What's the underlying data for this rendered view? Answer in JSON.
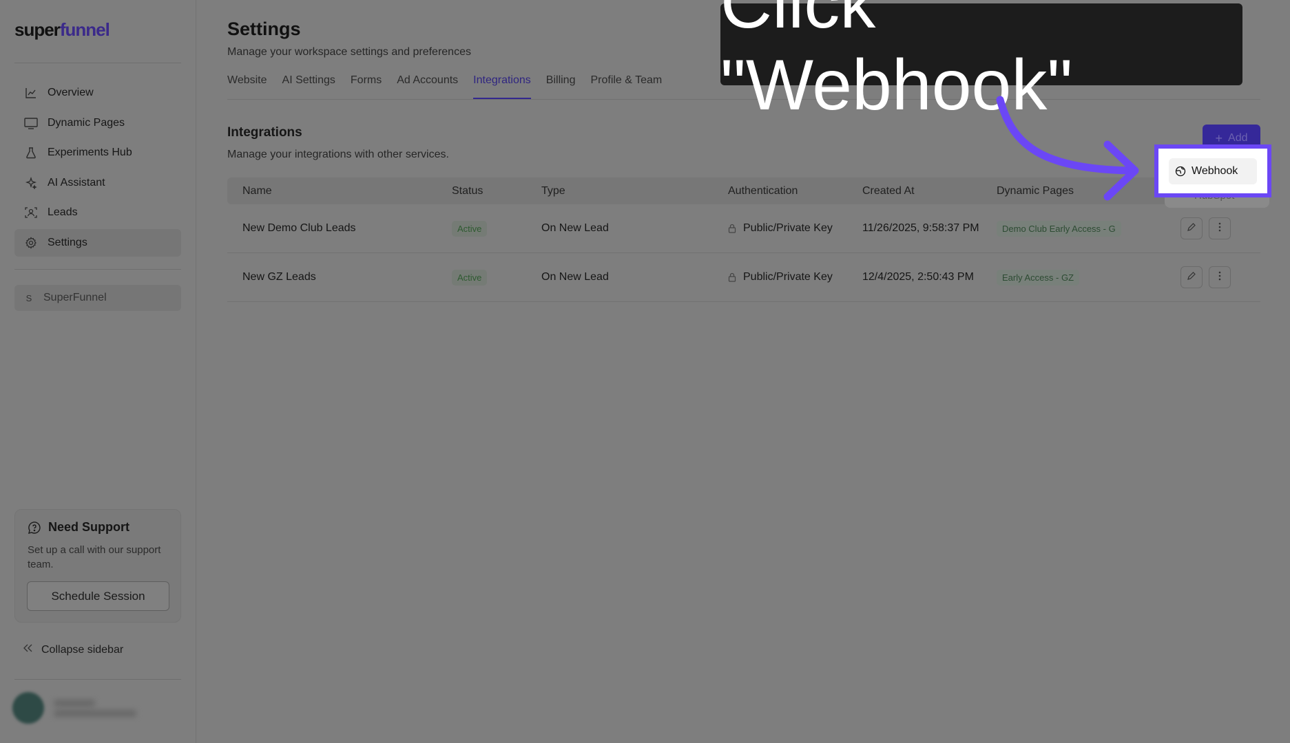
{
  "app": {
    "logo_prefix": "super",
    "logo_suffix": "funnel"
  },
  "sidebar": {
    "items": [
      {
        "label": "Overview",
        "icon": "chart-line-icon"
      },
      {
        "label": "Dynamic Pages",
        "icon": "monitor-icon"
      },
      {
        "label": "Experiments Hub",
        "icon": "flask-icon"
      },
      {
        "label": "AI Assistant",
        "icon": "sparkles-icon"
      },
      {
        "label": "Leads",
        "icon": "user-scan-icon"
      },
      {
        "label": "Settings",
        "icon": "gear-icon",
        "active": true
      }
    ],
    "workspace": {
      "letter": "S",
      "name": "SuperFunnel"
    },
    "support": {
      "title": "Need Support",
      "description": "Set up a call with our support team.",
      "button": "Schedule Session"
    },
    "collapse_label": "Collapse sidebar"
  },
  "header": {
    "title": "Settings",
    "subtitle": "Manage your workspace settings and preferences",
    "tabs": [
      "Website",
      "AI Settings",
      "Forms",
      "Ad Accounts",
      "Integrations",
      "Billing",
      "Profile & Team"
    ],
    "active_tab": "Integrations"
  },
  "integrations": {
    "title": "Integrations",
    "subtitle": "Manage your integrations with other services.",
    "add_label": "Add",
    "columns": [
      "Name",
      "Status",
      "Type",
      "Authentication",
      "Created At",
      "Dynamic Pages"
    ],
    "rows": [
      {
        "name": "New Demo Club Leads",
        "status": "Active",
        "type": "On New Lead",
        "auth": "Public/Private Key",
        "created": "11/26/2025, 9:58:37 PM",
        "page": "Demo Club Early Access - G"
      },
      {
        "name": "New GZ Leads",
        "status": "Active",
        "type": "On New Lead",
        "auth": "Public/Private Key",
        "created": "12/4/2025, 2:50:43 PM",
        "page": "Early Access - GZ"
      }
    ]
  },
  "dropdown": {
    "items": [
      "Webhook",
      "HubSpot"
    ]
  },
  "callout": {
    "text": "Click \"Webhook\""
  },
  "colors": {
    "accent": "#6b47f5",
    "overlay": "#7e7e7e",
    "callout_bg": "#1c1c1c"
  }
}
